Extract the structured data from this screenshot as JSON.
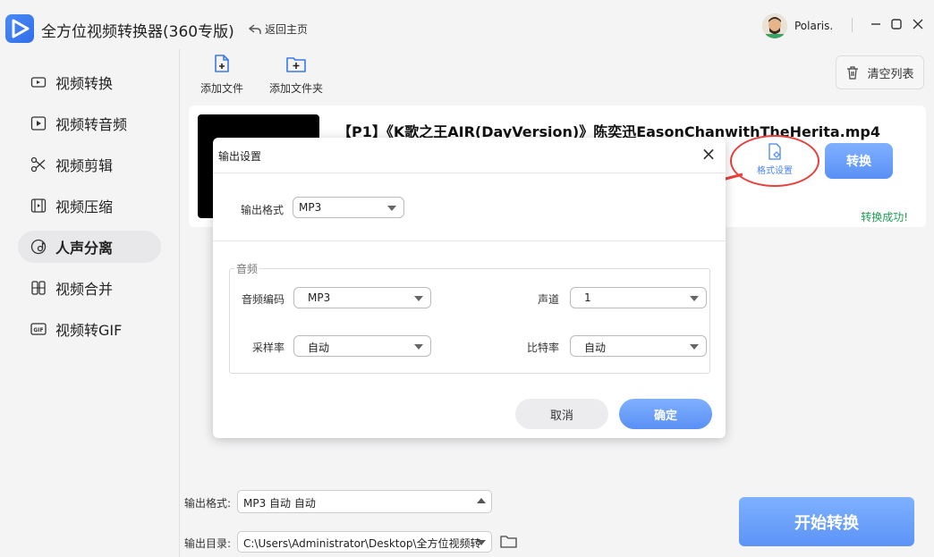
{
  "app": {
    "title": "全方位视频转换器(360专版)",
    "back_label": "返回主页",
    "username": "Polaris."
  },
  "sidebar": {
    "items": [
      {
        "label": "视频转换",
        "icon": "video-convert-icon"
      },
      {
        "label": "视频转音频",
        "icon": "video-to-audio-icon"
      },
      {
        "label": "视频剪辑",
        "icon": "scissors-icon"
      },
      {
        "label": "视频压缩",
        "icon": "compress-icon"
      },
      {
        "label": "人声分离",
        "icon": "vocal-separate-icon",
        "active": true
      },
      {
        "label": "视频合并",
        "icon": "merge-icon"
      },
      {
        "label": "视频转GIF",
        "icon": "gif-icon"
      }
    ]
  },
  "toolbar": {
    "add_file": "添加文件",
    "add_folder": "添加文件夹",
    "clear_list": "清空列表"
  },
  "file": {
    "name": "【P1】《K歌之王AIR(DayVersion)》陈奕迅EasonChanwithTheHerita.mp4",
    "format_setting": "格式设置",
    "convert": "转换",
    "status": "转换成功!"
  },
  "dialog": {
    "title": "输出设置",
    "output_format_label": "输出格式",
    "output_format_value": "MP3",
    "audio_group": "音频",
    "audio_codec_label": "音频编码",
    "audio_codec_value": "MP3",
    "channel_label": "声道",
    "channel_value": "1",
    "sample_rate_label": "采样率",
    "sample_rate_value": "自动",
    "bitrate_label": "比特率",
    "bitrate_value": "自动",
    "cancel": "取消",
    "ok": "确定"
  },
  "bottom": {
    "output_format_label": "输出格式:",
    "output_format_value": "MP3 自动 自动",
    "output_dir_label": "输出目录:",
    "output_dir_value": "C:\\Users\\Administrator\\Desktop\\全方位视频转",
    "start": "开始转换"
  },
  "colors": {
    "accent": "#5a90f5",
    "success": "#1f9d55",
    "highlight": "#e8403d"
  }
}
